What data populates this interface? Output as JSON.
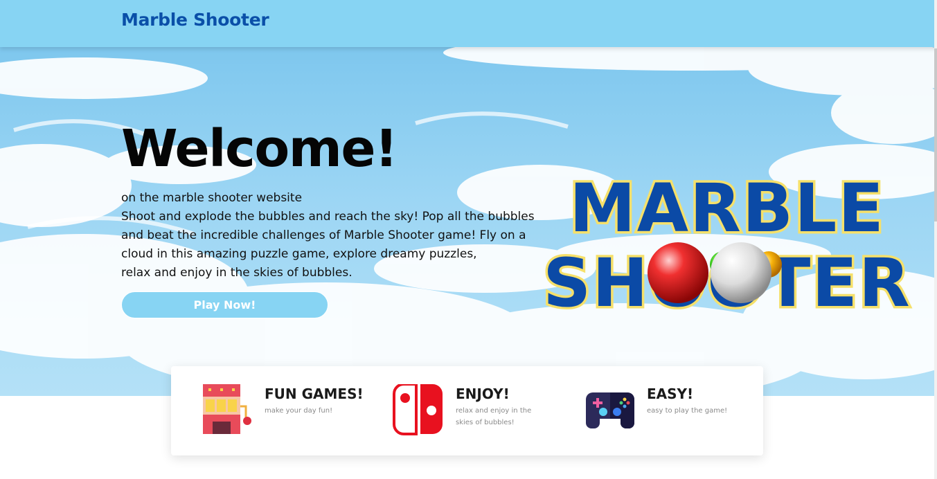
{
  "nav": {
    "brand": "Marble Shooter"
  },
  "hero": {
    "heading": "Welcome!",
    "intro_lines": [
      "on the marble shooter website",
      "Shoot and explode the bubbles and reach the sky! Pop all the bubbles",
      "and beat the incredible challenges of Marble Shooter game! Fly on a",
      "cloud in this amazing puzzle game, explore dreamy puzzles,",
      "relax and enjoy in the skies of bubbles."
    ],
    "play_button": "Play Now!",
    "logo": {
      "line1": "MARBLE",
      "line2": "SHOOTER"
    }
  },
  "features": [
    {
      "title": "FUN GAMES!",
      "desc": "make your day fun!",
      "icon": "slot-machine-icon"
    },
    {
      "title": "ENJOY!",
      "desc": "relax and enjoy in the skies of bubbles!",
      "icon": "game-console-icon"
    },
    {
      "title": "EASY!",
      "desc": "easy to play the game!",
      "icon": "gamepad-icon"
    }
  ],
  "colors": {
    "nav_bg": "#87d4f3",
    "brand": "#0a4fa8",
    "logo_blue": "#0b4aa6",
    "logo_outline": "#f5e06a"
  }
}
